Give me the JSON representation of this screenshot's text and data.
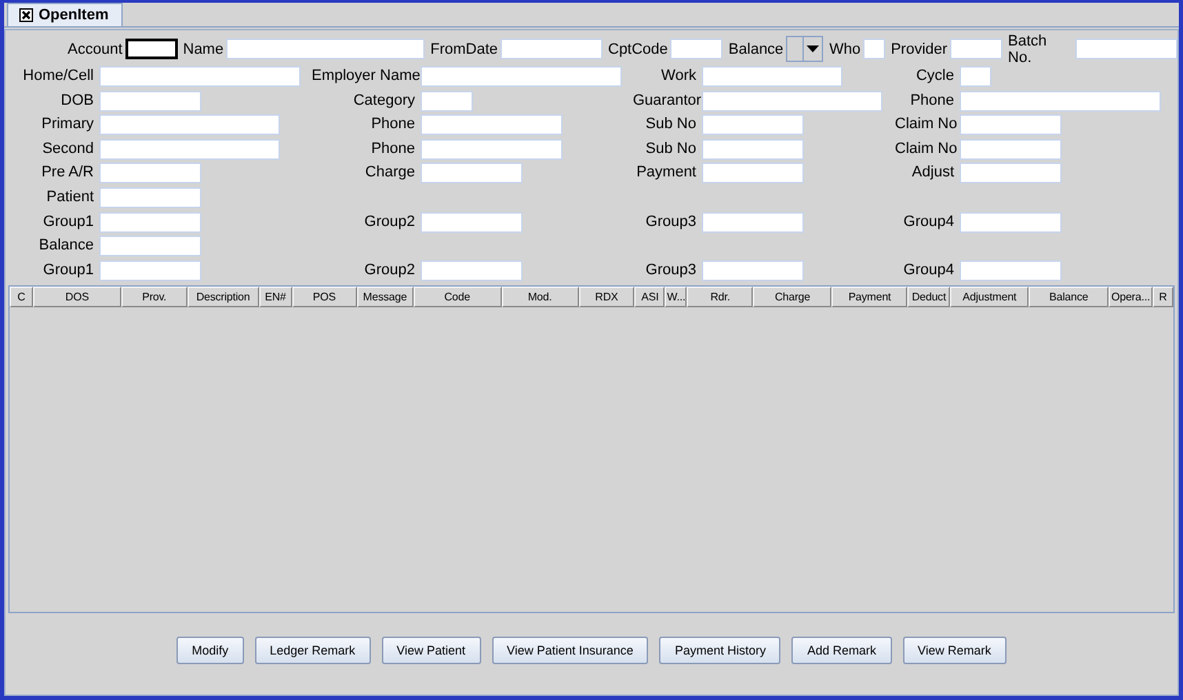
{
  "window": {
    "title": "OpenItem"
  },
  "top_fields": [
    {
      "label": "Account",
      "kind": "text",
      "focused": true
    },
    {
      "label": "Name",
      "kind": "text",
      "focused": false
    },
    {
      "label": "FromDate",
      "kind": "text",
      "focused": false
    },
    {
      "label": "CptCode",
      "kind": "text",
      "focused": false
    },
    {
      "label": "Balance",
      "kind": "dropdown",
      "focused": false
    },
    {
      "label": "Who",
      "kind": "text",
      "focused": false
    },
    {
      "label": "Provider",
      "kind": "text",
      "focused": false
    },
    {
      "label": "Batch No.",
      "kind": "text",
      "focused": false
    }
  ],
  "form_rows": [
    [
      {
        "label": "Home/Cell"
      },
      {
        "label": "Employer Name"
      },
      {
        "label": "Work"
      },
      {
        "label": "Cycle"
      }
    ],
    [
      {
        "label": "DOB"
      },
      {
        "label": "Category"
      },
      {
        "label": "Guarantor"
      },
      {
        "label": "Phone"
      }
    ],
    [
      {
        "label": "Primary"
      },
      {
        "label": "Phone"
      },
      {
        "label": "Sub No"
      },
      {
        "label": "Claim No"
      }
    ],
    [
      {
        "label": "Second"
      },
      {
        "label": "Phone"
      },
      {
        "label": "Sub No"
      },
      {
        "label": "Claim No"
      }
    ],
    [
      {
        "label": "Pre A/R"
      },
      {
        "label": "Charge"
      },
      {
        "label": "Payment"
      },
      {
        "label": "Adjust"
      }
    ],
    [
      {
        "label": "Patient"
      },
      null,
      null,
      null
    ],
    [
      {
        "label": "Group1"
      },
      {
        "label": "Group2"
      },
      {
        "label": "Group3"
      },
      {
        "label": "Group4"
      }
    ],
    [
      {
        "label": "Balance"
      },
      null,
      null,
      null
    ],
    [
      {
        "label": "Group1"
      },
      {
        "label": "Group2"
      },
      {
        "label": "Group3"
      },
      {
        "label": "Group4"
      }
    ]
  ],
  "table": {
    "columns": [
      "C",
      "DOS",
      "Prov.",
      "Description",
      "EN#",
      "POS",
      "Message",
      "Code",
      "Mod.",
      "RDX",
      "ASI",
      "W...",
      "Rdr.",
      "Charge",
      "Payment",
      "Deduct",
      "Adjustment",
      "Balance",
      "Opera...",
      "R"
    ]
  },
  "buttons": [
    "Modify",
    "Ledger Remark",
    "View Patient",
    "View Patient Insurance",
    "Payment History",
    "Add Remark",
    "View Remark"
  ]
}
